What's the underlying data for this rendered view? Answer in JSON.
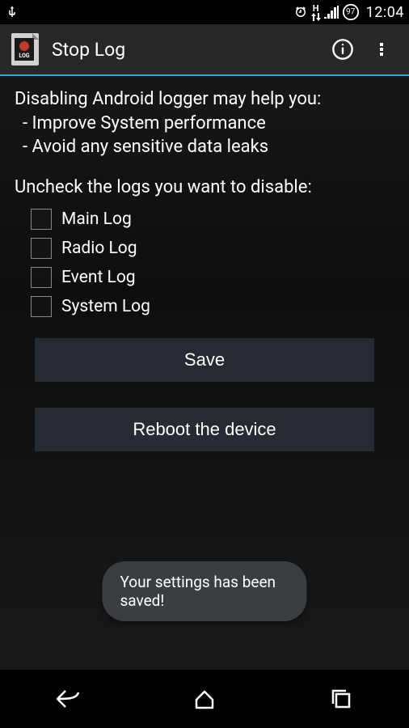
{
  "status": {
    "time": "12:04",
    "battery_percent": "97",
    "network_indicator": "H"
  },
  "header": {
    "title": "Stop Log"
  },
  "intro": {
    "heading": "Disabling Android logger may help you:",
    "bullet1": " - Improve System performance",
    "bullet2": " - Avoid any sensitive data leaks"
  },
  "instruction": "Uncheck the logs you want to disable:",
  "logs": [
    {
      "label": "Main Log"
    },
    {
      "label": "Radio Log"
    },
    {
      "label": "Event Log"
    },
    {
      "label": "System Log"
    }
  ],
  "buttons": {
    "save": "Save",
    "reboot": "Reboot the device"
  },
  "toast": "Your settings has been saved!"
}
